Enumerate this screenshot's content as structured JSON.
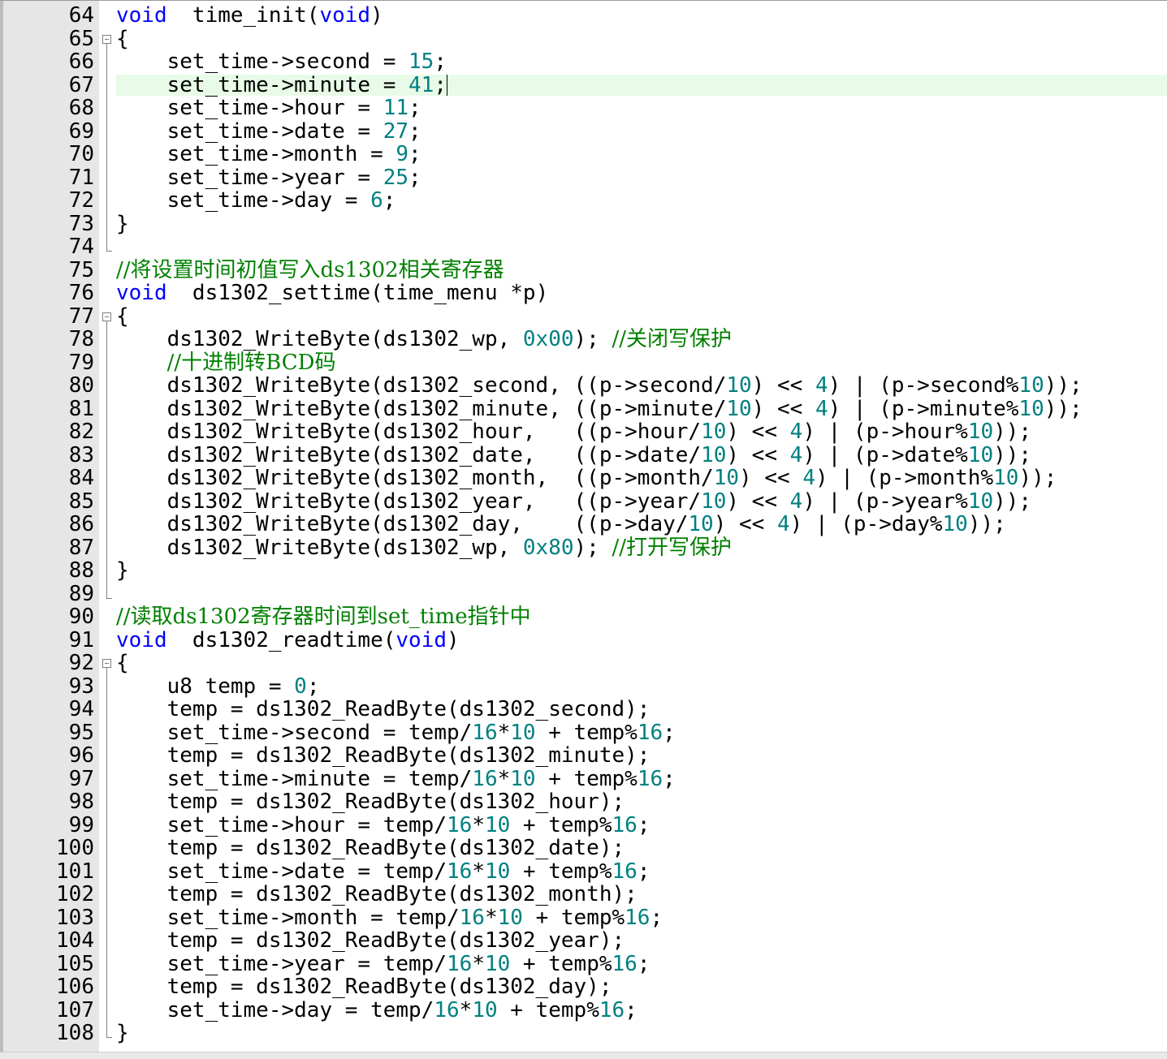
{
  "editor": {
    "lines": [
      {
        "n": "64",
        "fold": "",
        "tokens": [
          [
            "kw",
            "void"
          ],
          [
            "",
            "  time_init("
          ],
          [
            "kw",
            "void"
          ],
          [
            "",
            ")"
          ]
        ]
      },
      {
        "n": "65",
        "fold": "open",
        "tokens": [
          [
            "",
            "{"
          ]
        ]
      },
      {
        "n": "66",
        "fold": "vl",
        "tokens": [
          [
            "",
            "    set_time->second = "
          ],
          [
            "num",
            "15"
          ],
          [
            "",
            ";"
          ]
        ]
      },
      {
        "n": "67",
        "fold": "vl",
        "current": true,
        "tokens": [
          [
            "",
            "    set_time->minute = "
          ],
          [
            "num",
            "41"
          ],
          [
            "",
            ";"
          ],
          [
            "caret",
            ""
          ]
        ]
      },
      {
        "n": "68",
        "fold": "vl",
        "tokens": [
          [
            "",
            "    set_time->hour = "
          ],
          [
            "num",
            "11"
          ],
          [
            "",
            ";"
          ]
        ]
      },
      {
        "n": "69",
        "fold": "vl",
        "tokens": [
          [
            "",
            "    set_time->date = "
          ],
          [
            "num",
            "27"
          ],
          [
            "",
            ";"
          ]
        ]
      },
      {
        "n": "70",
        "fold": "vl",
        "tokens": [
          [
            "",
            "    set_time->month = "
          ],
          [
            "num",
            "9"
          ],
          [
            "",
            ";"
          ]
        ]
      },
      {
        "n": "71",
        "fold": "vl",
        "tokens": [
          [
            "",
            "    set_time->year = "
          ],
          [
            "num",
            "25"
          ],
          [
            "",
            ";"
          ]
        ]
      },
      {
        "n": "72",
        "fold": "vl",
        "tokens": [
          [
            "",
            "    set_time->day = "
          ],
          [
            "num",
            "6"
          ],
          [
            "",
            ";"
          ]
        ]
      },
      {
        "n": "73",
        "fold": "vl",
        "tokens": [
          [
            "",
            "}"
          ]
        ]
      },
      {
        "n": "74",
        "fold": "end",
        "tokens": []
      },
      {
        "n": "75",
        "fold": "",
        "tokens": [
          [
            "cm",
            "//将设置时间初值写入ds1302相关寄存器"
          ]
        ]
      },
      {
        "n": "76",
        "fold": "",
        "tokens": [
          [
            "kw",
            "void"
          ],
          [
            "",
            "  ds1302_settime(time_menu *p)"
          ]
        ]
      },
      {
        "n": "77",
        "fold": "open",
        "tokens": [
          [
            "",
            "{"
          ]
        ]
      },
      {
        "n": "78",
        "fold": "vl",
        "tokens": [
          [
            "",
            "    ds1302_WriteByte(ds1302_wp, "
          ],
          [
            "num",
            "0x00"
          ],
          [
            "",
            "); "
          ],
          [
            "cm",
            "//关闭写保护"
          ]
        ]
      },
      {
        "n": "79",
        "fold": "vl",
        "tokens": [
          [
            "",
            "    "
          ],
          [
            "cm",
            "//十进制转BCD码"
          ]
        ]
      },
      {
        "n": "80",
        "fold": "vl",
        "tokens": [
          [
            "",
            "    ds1302_WriteByte(ds1302_second, ((p->second/"
          ],
          [
            "num",
            "10"
          ],
          [
            "",
            ") << "
          ],
          [
            "num",
            "4"
          ],
          [
            "",
            ") | (p->second%"
          ],
          [
            "num",
            "10"
          ],
          [
            "",
            "));"
          ]
        ]
      },
      {
        "n": "81",
        "fold": "vl",
        "tokens": [
          [
            "",
            "    ds1302_WriteByte(ds1302_minute, ((p->minute/"
          ],
          [
            "num",
            "10"
          ],
          [
            "",
            ") << "
          ],
          [
            "num",
            "4"
          ],
          [
            "",
            ") | (p->minute%"
          ],
          [
            "num",
            "10"
          ],
          [
            "",
            "));"
          ]
        ]
      },
      {
        "n": "82",
        "fold": "vl",
        "tokens": [
          [
            "",
            "    ds1302_WriteByte(ds1302_hour,   ((p->hour/"
          ],
          [
            "num",
            "10"
          ],
          [
            "",
            ") << "
          ],
          [
            "num",
            "4"
          ],
          [
            "",
            ") | (p->hour%"
          ],
          [
            "num",
            "10"
          ],
          [
            "",
            "));"
          ]
        ]
      },
      {
        "n": "83",
        "fold": "vl",
        "tokens": [
          [
            "",
            "    ds1302_WriteByte(ds1302_date,   ((p->date/"
          ],
          [
            "num",
            "10"
          ],
          [
            "",
            ") << "
          ],
          [
            "num",
            "4"
          ],
          [
            "",
            ") | (p->date%"
          ],
          [
            "num",
            "10"
          ],
          [
            "",
            "));"
          ]
        ]
      },
      {
        "n": "84",
        "fold": "vl",
        "tokens": [
          [
            "",
            "    ds1302_WriteByte(ds1302_month,  ((p->month/"
          ],
          [
            "num",
            "10"
          ],
          [
            "",
            ") << "
          ],
          [
            "num",
            "4"
          ],
          [
            "",
            ") | (p->month%"
          ],
          [
            "num",
            "10"
          ],
          [
            "",
            "));"
          ]
        ]
      },
      {
        "n": "85",
        "fold": "vl",
        "tokens": [
          [
            "",
            "    ds1302_WriteByte(ds1302_year,   ((p->year/"
          ],
          [
            "num",
            "10"
          ],
          [
            "",
            ") << "
          ],
          [
            "num",
            "4"
          ],
          [
            "",
            ") | (p->year%"
          ],
          [
            "num",
            "10"
          ],
          [
            "",
            "));"
          ]
        ]
      },
      {
        "n": "86",
        "fold": "vl",
        "tokens": [
          [
            "",
            "    ds1302_WriteByte(ds1302_day,    ((p->day/"
          ],
          [
            "num",
            "10"
          ],
          [
            "",
            ") << "
          ],
          [
            "num",
            "4"
          ],
          [
            "",
            ") | (p->day%"
          ],
          [
            "num",
            "10"
          ],
          [
            "",
            "));"
          ]
        ]
      },
      {
        "n": "87",
        "fold": "vl",
        "tokens": [
          [
            "",
            "    ds1302_WriteByte(ds1302_wp, "
          ],
          [
            "num",
            "0x80"
          ],
          [
            "",
            "); "
          ],
          [
            "cm",
            "//打开写保护"
          ]
        ]
      },
      {
        "n": "88",
        "fold": "vl",
        "tokens": [
          [
            "",
            "}"
          ]
        ]
      },
      {
        "n": "89",
        "fold": "end",
        "tokens": []
      },
      {
        "n": "90",
        "fold": "",
        "tokens": [
          [
            "cm",
            "//读取ds1302寄存器时间到set_time指针中"
          ]
        ]
      },
      {
        "n": "91",
        "fold": "",
        "tokens": [
          [
            "kw",
            "void"
          ],
          [
            "",
            "  ds1302_readtime("
          ],
          [
            "kw",
            "void"
          ],
          [
            "",
            ")"
          ]
        ]
      },
      {
        "n": "92",
        "fold": "open",
        "tokens": [
          [
            "",
            "{"
          ]
        ]
      },
      {
        "n": "93",
        "fold": "vl",
        "tokens": [
          [
            "",
            "    u8 temp = "
          ],
          [
            "num",
            "0"
          ],
          [
            "",
            ";"
          ]
        ]
      },
      {
        "n": "94",
        "fold": "vl",
        "tokens": [
          [
            "",
            "    temp = ds1302_ReadByte(ds1302_second);"
          ]
        ]
      },
      {
        "n": "95",
        "fold": "vl",
        "tokens": [
          [
            "",
            "    set_time->second = temp/"
          ],
          [
            "num",
            "16"
          ],
          [
            "",
            "*"
          ],
          [
            "num",
            "10"
          ],
          [
            "",
            " + temp%"
          ],
          [
            "num",
            "16"
          ],
          [
            "",
            ";"
          ]
        ]
      },
      {
        "n": "96",
        "fold": "vl",
        "tokens": [
          [
            "",
            "    temp = ds1302_ReadByte(ds1302_minute);"
          ]
        ]
      },
      {
        "n": "97",
        "fold": "vl",
        "tokens": [
          [
            "",
            "    set_time->minute = temp/"
          ],
          [
            "num",
            "16"
          ],
          [
            "",
            "*"
          ],
          [
            "num",
            "10"
          ],
          [
            "",
            " + temp%"
          ],
          [
            "num",
            "16"
          ],
          [
            "",
            ";"
          ]
        ]
      },
      {
        "n": "98",
        "fold": "vl",
        "tokens": [
          [
            "",
            "    temp = ds1302_ReadByte(ds1302_hour);"
          ]
        ]
      },
      {
        "n": "99",
        "fold": "vl",
        "tokens": [
          [
            "",
            "    set_time->hour = temp/"
          ],
          [
            "num",
            "16"
          ],
          [
            "",
            "*"
          ],
          [
            "num",
            "10"
          ],
          [
            "",
            " + temp%"
          ],
          [
            "num",
            "16"
          ],
          [
            "",
            ";"
          ]
        ]
      },
      {
        "n": "100",
        "fold": "vl",
        "tokens": [
          [
            "",
            "    temp = ds1302_ReadByte(ds1302_date);"
          ]
        ]
      },
      {
        "n": "101",
        "fold": "vl",
        "tokens": [
          [
            "",
            "    set_time->date = temp/"
          ],
          [
            "num",
            "16"
          ],
          [
            "",
            "*"
          ],
          [
            "num",
            "10"
          ],
          [
            "",
            " + temp%"
          ],
          [
            "num",
            "16"
          ],
          [
            "",
            ";"
          ]
        ]
      },
      {
        "n": "102",
        "fold": "vl",
        "tokens": [
          [
            "",
            "    temp = ds1302_ReadByte(ds1302_month);"
          ]
        ]
      },
      {
        "n": "103",
        "fold": "vl",
        "tokens": [
          [
            "",
            "    set_time->month = temp/"
          ],
          [
            "num",
            "16"
          ],
          [
            "",
            "*"
          ],
          [
            "num",
            "10"
          ],
          [
            "",
            " + temp%"
          ],
          [
            "num",
            "16"
          ],
          [
            "",
            ";"
          ]
        ]
      },
      {
        "n": "104",
        "fold": "vl",
        "tokens": [
          [
            "",
            "    temp = ds1302_ReadByte(ds1302_year);"
          ]
        ]
      },
      {
        "n": "105",
        "fold": "vl",
        "tokens": [
          [
            "",
            "    set_time->year = temp/"
          ],
          [
            "num",
            "16"
          ],
          [
            "",
            "*"
          ],
          [
            "num",
            "10"
          ],
          [
            "",
            " + temp%"
          ],
          [
            "num",
            "16"
          ],
          [
            "",
            ";"
          ]
        ]
      },
      {
        "n": "106",
        "fold": "vl",
        "tokens": [
          [
            "",
            "    temp = ds1302_ReadByte(ds1302_day);"
          ]
        ]
      },
      {
        "n": "107",
        "fold": "vl",
        "tokens": [
          [
            "",
            "    set_time->day = temp/"
          ],
          [
            "num",
            "16"
          ],
          [
            "",
            "*"
          ],
          [
            "num",
            "10"
          ],
          [
            "",
            " + temp%"
          ],
          [
            "num",
            "16"
          ],
          [
            "",
            ";"
          ]
        ]
      },
      {
        "n": "108",
        "fold": "end",
        "tokens": [
          [
            "",
            "}"
          ]
        ]
      }
    ]
  }
}
